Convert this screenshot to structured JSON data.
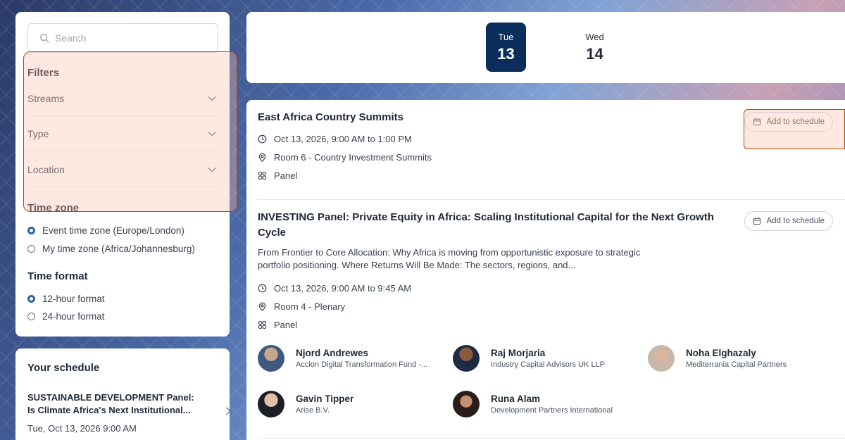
{
  "search": {
    "placeholder": "Search"
  },
  "filters": {
    "title": "Filters",
    "rows": [
      {
        "label": "Streams"
      },
      {
        "label": "Type"
      },
      {
        "label": "Location"
      }
    ]
  },
  "timezone": {
    "title": "Time zone",
    "options": [
      {
        "label": "Event time zone (Europe/London)",
        "selected": true
      },
      {
        "label": "My time zone (Africa/Johannesburg)",
        "selected": false
      }
    ]
  },
  "timeformat": {
    "title": "Time format",
    "options": [
      {
        "label": "12-hour format",
        "selected": true
      },
      {
        "label": "24-hour format",
        "selected": false
      }
    ]
  },
  "schedule": {
    "title": "Your schedule",
    "item": {
      "title": "SUSTAINABLE DEVELOPMENT Panel: Is Climate Africa's Next Institutional...",
      "date": "Tue, Oct 13, 2026 9:00 AM"
    }
  },
  "days": [
    {
      "name": "Tue",
      "num": "13",
      "selected": true
    },
    {
      "name": "Wed",
      "num": "14",
      "selected": false
    }
  ],
  "sessions": [
    {
      "title": "East Africa Country Summits",
      "time": "Oct 13, 2026, 9:00 AM to 1:00 PM",
      "location": "Room 6 - Country Investment Summits",
      "type": "Panel",
      "button": "Add to schedule"
    },
    {
      "title": "INVESTING Panel: Private Equity in Africa: Scaling Institutional Capital for the Next Growth Cycle",
      "description": "From Frontier to Core Allocation: Why Africa is moving from opportunistic exposure to strategic portfolio positioning. Where Returns Will Be Made: The sectors, regions, and...",
      "time": "Oct 13, 2026, 9:00 AM to 9:45 AM",
      "location": "Room 4 - Plenary",
      "type": "Panel",
      "button": "Add to schedule",
      "speakers": [
        {
          "name": "Njord Andrewes",
          "org": "Accion Digital Transformation Fund -..."
        },
        {
          "name": "Raj Morjaria",
          "org": "Industry Capital Advisors UK LLP"
        },
        {
          "name": "Noha Elghazaly",
          "org": "Mediterrania Capital Partners"
        },
        {
          "name": "Gavin Tipper",
          "org": "Arise B.V."
        },
        {
          "name": "Runa Alam",
          "org": "Development Partners International"
        }
      ]
    }
  ],
  "colors": {
    "accent": "#0b2d5c",
    "highlight": "#c2410c",
    "radio_on": "#2f5fa8"
  }
}
